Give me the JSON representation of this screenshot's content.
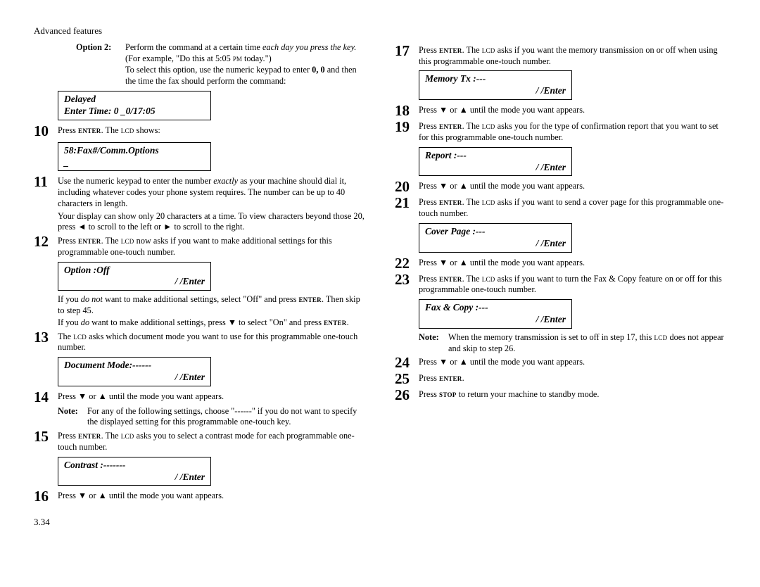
{
  "header": "Advanced features",
  "page_number": "3.34",
  "left": {
    "option2_label": "Option 2:",
    "option2_text": "Perform the command at a certain time each day you press the key. (For example, \"Do this at 5:05 PM today.\")",
    "option2_text2": "To select this option, use the numeric keypad to enter 0, 0 and then the time the fax should perform the command:",
    "lcd_delayed_l1": "Delayed",
    "lcd_delayed_l2": "Enter Time: 0 _0/17:05",
    "s10": "Press ENTER. The LCD shows:",
    "lcd_58_l1": "58:Fax#/Comm.Options",
    "lcd_58_l2": "_",
    "s11": "Use the numeric keypad to enter the number exactly as your machine should dial it, including whatever codes your phone system requires. The number can be up to 40 characters in length.",
    "s11b": "Your display can show only 20 characters at a time. To view characters beyond those 20, press ◄ to scroll to the left or ► to scroll to the right.",
    "s12": "Press ENTER. The LCD now asks if you want to make additional settings for this programmable one-touch number.",
    "lcd_opt_l1": "Option          :Off",
    "lcd_opt_l2": "/    /Enter",
    "s12b": "If you do not want to make additional settings, select \"Off\" and press ENTER. Then skip to step 45.",
    "s12c": "If you do want to make additional settings, press ▼ to select \"On\" and press ENTER.",
    "s13": "The LCD asks which document mode you want to use for this programmable one-touch number.",
    "lcd_doc_l1": "Document Mode:------",
    "lcd_doc_l2": "/    /Enter",
    "s14": "Press ▼ or ▲ until the mode you want appears.",
    "note14_label": "Note:",
    "note14": "For any of the following settings, choose \"------\" if you do not want to specify the displayed setting for this programmable one-touch key.",
    "s15": "Press ENTER. The LCD asks you to select a contrast mode for each programmable one-touch number.",
    "lcd_con_l1": "Contrast    :-------",
    "lcd_con_l2": "/    /Enter",
    "s16": "Press ▼ or ▲ until the mode you want appears."
  },
  "right": {
    "s17": "Press ENTER. The LCD asks if you want the memory transmission on or off when using this programmable one-touch number.",
    "lcd_mem_l1": "Memory Tx      :---",
    "lcd_mem_l2": "/    /Enter",
    "s18": "Press ▼ or ▲ until the mode you want appears.",
    "s19": "Press ENTER. The LCD asks you for the type of confirmation report that you want to set for this programmable one-touch number.",
    "lcd_rep_l1": "Report        :---",
    "lcd_rep_l2": "/    /Enter",
    "s20": "Press ▼ or ▲ until the mode you want appears.",
    "s21": "Press ENTER. The LCD asks if you want to send a cover page for this programmable one-touch number.",
    "lcd_cov_l1": "Cover Page    :---",
    "lcd_cov_l2": "/    /Enter",
    "s22": "Press ▼ or ▲ until the mode you want appears.",
    "s23": "Press ENTER. The LCD asks if you want to turn the Fax & Copy feature on or off for this programmable one-touch number.",
    "lcd_fc_l1": "Fax & Copy    :---",
    "lcd_fc_l2": "/    /Enter",
    "note23_label": "Note:",
    "note23": "When the memory transmission is set to off in step 17, this LCD does not appear and skip to step 26.",
    "s24": "Press ▼ or ▲ until the mode you want appears.",
    "s25": "Press ENTER.",
    "s26": "Press STOP to return your machine to standby mode."
  }
}
